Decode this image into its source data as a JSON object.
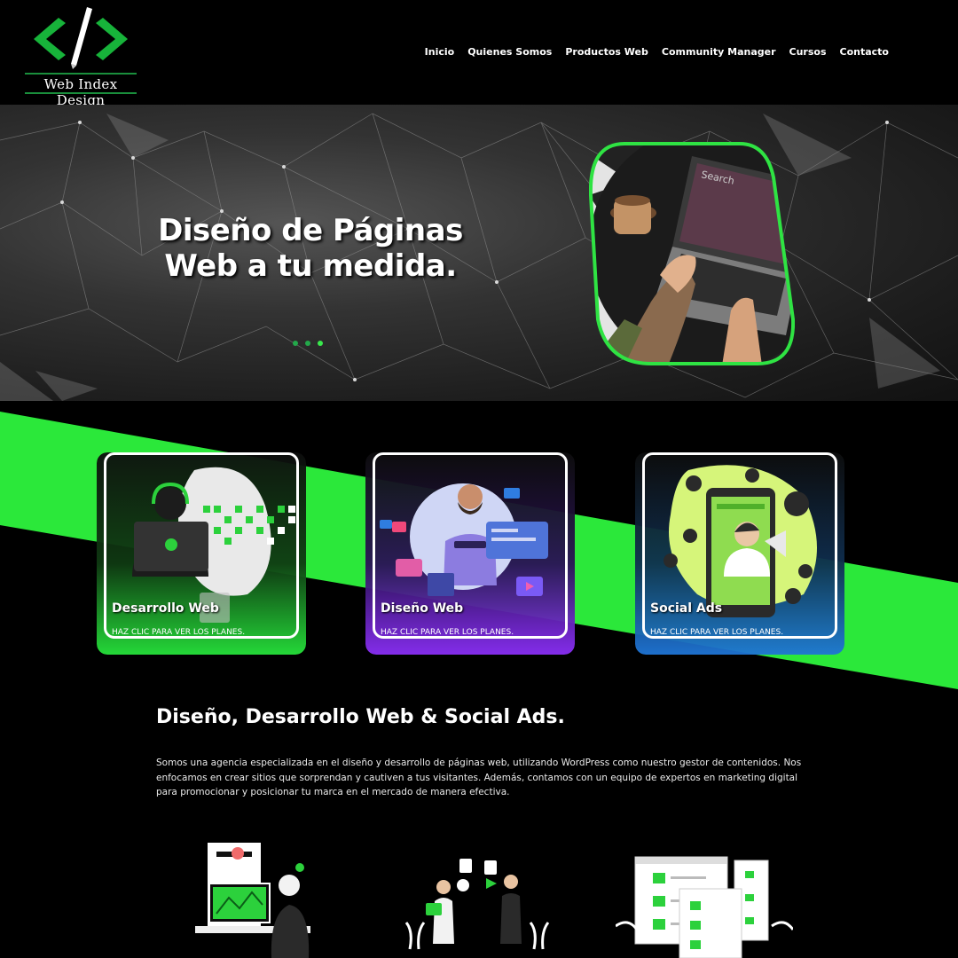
{
  "brand": {
    "name": "Web Index Design",
    "accent": "#39e94c",
    "dark_green": "#1a8f3c"
  },
  "nav": {
    "items": [
      "Inicio",
      "Quienes Somos",
      "Productos Web",
      "Community Manager",
      "Cursos",
      "Contacto"
    ]
  },
  "hero": {
    "title": "Diseño de Páginas Web a tu medida.",
    "slides": 3,
    "active_slide": 3,
    "photo_search_text": "Search"
  },
  "services": [
    {
      "title": "Desarrollo Web",
      "cta": "HAZ CLIC PARA VER LOS PLANES.",
      "color": "#22c93a"
    },
    {
      "title": "Diseño Web",
      "cta": "HAZ CLIC PARA VER LOS PLANES.",
      "color": "#7d2ff0"
    },
    {
      "title": "Social Ads",
      "cta": "HAZ CLIC PARA VER LOS PLANES.",
      "color": "#1f6fd0"
    }
  ],
  "about": {
    "title": "Diseño, Desarrollo Web & Social Ads.",
    "text": "Somos una agencia especializada en el diseño y desarrollo de páginas web, utilizando WordPress como nuestro  gestor de contenidos. Nos enfocamos en crear sitios que sorprendan y cautiven a tus visitantes. Además, contamos con un equipo de expertos en marketing digital para promocionar y posicionar tu marca en el mercado de manera efectiva."
  },
  "illustrations": [
    "developer-illustration",
    "social-media-illustration",
    "web-pages-illustration"
  ]
}
